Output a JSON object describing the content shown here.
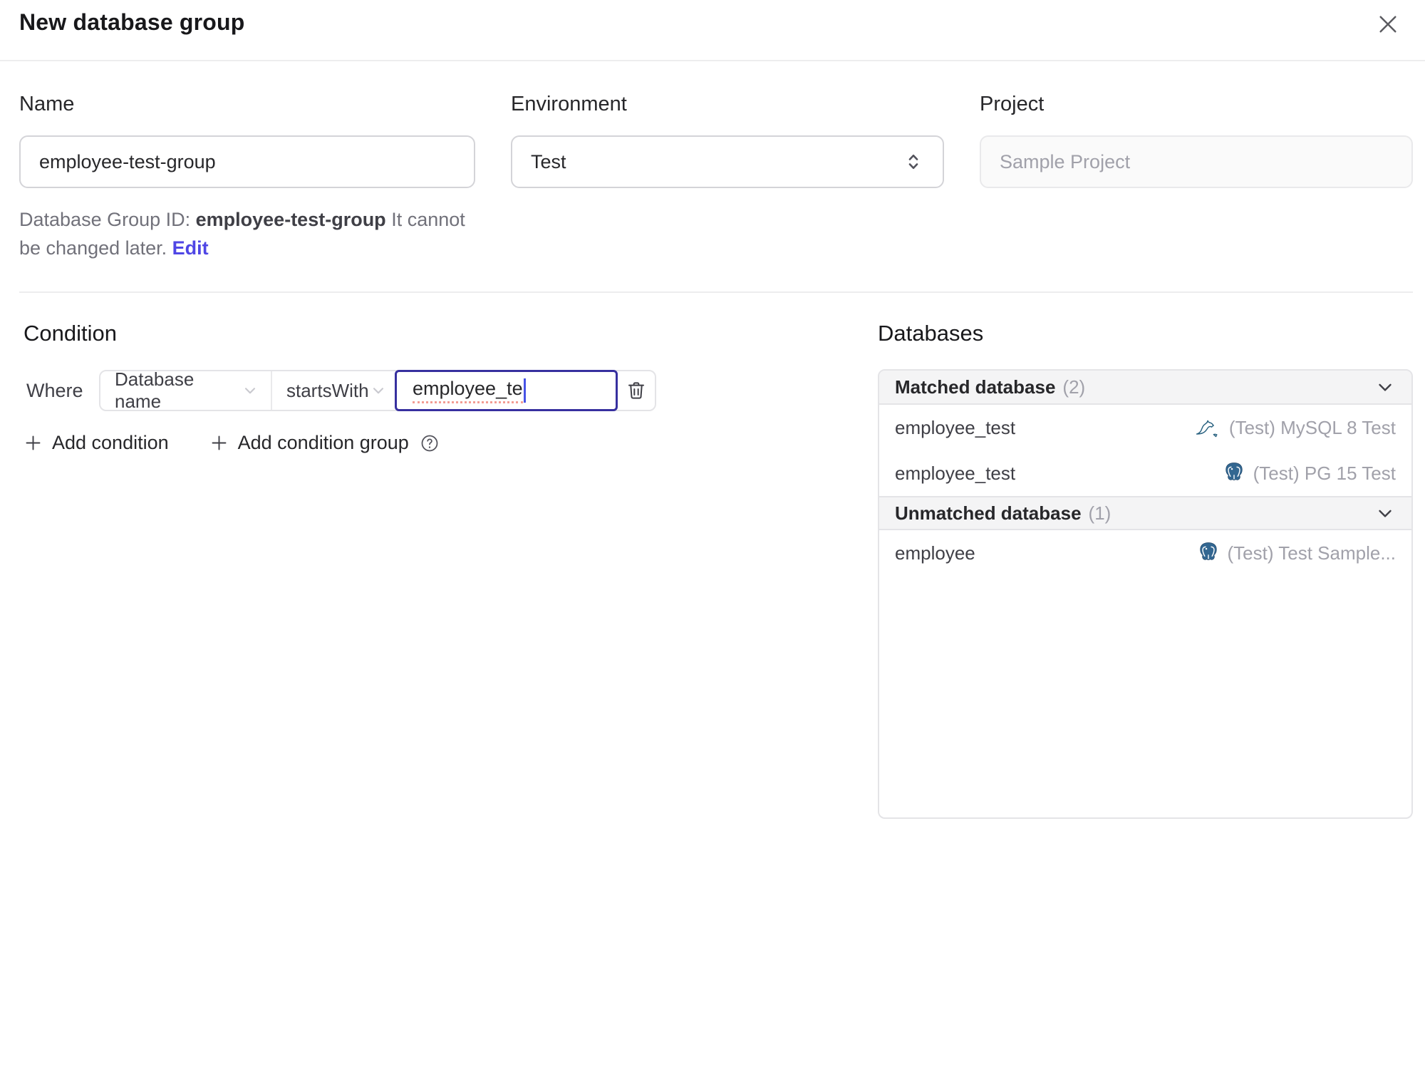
{
  "dialog": {
    "title": "New database group"
  },
  "form": {
    "name": {
      "label": "Name",
      "value": "employee-test-group"
    },
    "environment": {
      "label": "Environment",
      "value": "Test"
    },
    "project": {
      "label": "Project",
      "value": "Sample Project"
    },
    "group_id_help": {
      "prefix": "Database Group ID: ",
      "id": "employee-test-group",
      "suffix": " It cannot be changed later. ",
      "edit_label": "Edit"
    }
  },
  "condition": {
    "heading": "Condition",
    "where_label": "Where",
    "factor_selected": "Database name",
    "operator_selected": "startsWith",
    "value": "employee_te",
    "add_condition_label": "Add condition",
    "add_condition_group_label": "Add condition group"
  },
  "databases": {
    "heading": "Databases",
    "matched": {
      "title": "Matched database",
      "count": "(2)",
      "rows": [
        {
          "name": "employee_test",
          "engine": "mysql",
          "instance": "(Test) MySQL 8 Test"
        },
        {
          "name": "employee_test",
          "engine": "postgres",
          "instance": "(Test) PG 15 Test"
        }
      ]
    },
    "unmatched": {
      "title": "Unmatched database",
      "count": "(1)",
      "rows": [
        {
          "name": "employee",
          "engine": "postgres",
          "instance": "(Test) Test Sample..."
        }
      ]
    }
  },
  "colors": {
    "accent": "#4f46e5",
    "focus_border": "#37309f",
    "mysql_icon": "#00618a",
    "postgres_icon": "#336791",
    "muted_text": "#a1a1aa"
  }
}
